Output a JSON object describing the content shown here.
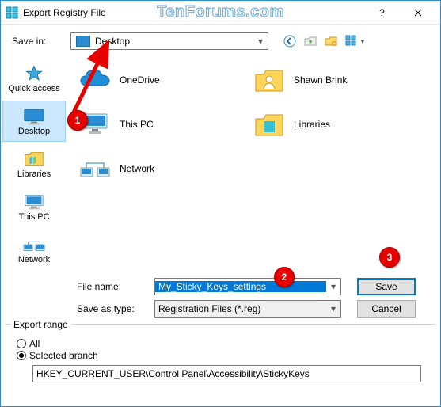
{
  "titlebar": {
    "title": "Export Registry File",
    "watermark": "TenForums.com"
  },
  "winbtns": {
    "help": "?",
    "close": "×"
  },
  "savein": {
    "label": "Save in:",
    "value": "Desktop"
  },
  "nav": {
    "back": "back-icon",
    "up": "up-one-level-icon",
    "newfolder": "new-folder-icon",
    "views": "view-menu-icon"
  },
  "sidebar": {
    "items": [
      {
        "label": "Quick access",
        "icon": "star"
      },
      {
        "label": "Desktop",
        "icon": "desktop",
        "selected": true
      },
      {
        "label": "Libraries",
        "icon": "libraries"
      },
      {
        "label": "This PC",
        "icon": "thispc"
      },
      {
        "label": "Network",
        "icon": "network"
      }
    ]
  },
  "filepane": {
    "items": [
      {
        "label": "OneDrive",
        "icon": "onedrive"
      },
      {
        "label": "Shawn Brink",
        "icon": "userfolder"
      },
      {
        "label": "This PC",
        "icon": "thispc"
      },
      {
        "label": "Libraries",
        "icon": "libraries"
      },
      {
        "label": "Network",
        "icon": "network"
      }
    ]
  },
  "fields": {
    "filename_label": "File name:",
    "filename_value": "My_Sticky_Keys_settings",
    "type_label": "Save as type:",
    "type_value": "Registration Files (*.reg)",
    "save": "Save",
    "cancel": "Cancel"
  },
  "export": {
    "title": "Export range",
    "all": "All",
    "selected": "Selected branch",
    "branch": "HKEY_CURRENT_USER\\Control Panel\\Accessibility\\StickyKeys"
  },
  "annotations": {
    "m1": "1",
    "m2": "2",
    "m3": "3"
  }
}
